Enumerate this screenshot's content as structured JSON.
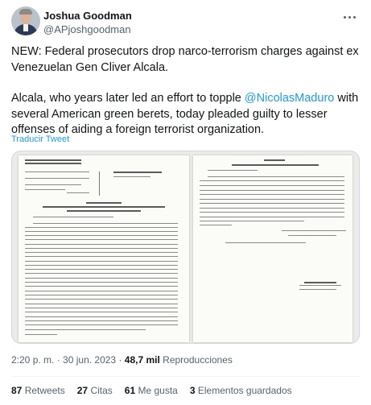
{
  "author": {
    "display_name": "Joshua Goodman",
    "handle": "@APjoshgoodman"
  },
  "tweet": {
    "line1": "NEW: Federal prosecutors drop narco-terrorism charges against ex Venezuelan Gen Cliver Alcala.",
    "line2_before": "Alcala, who years later led an effort to topple ",
    "mention": "@NicolasMaduro",
    "line2_after": " with several American green berets, today pleaded guilty to lesser offenses of aiding a foreign terrorist organization.",
    "translate_label": "Traducir Tweet"
  },
  "media": {
    "description": "Scanned court document pages"
  },
  "meta": {
    "time": "2:20 p. m.",
    "separator": " · ",
    "date": "30 jun. 2023",
    "views_count": "48,7 mil",
    "views_label": "Reproducciones"
  },
  "stats": {
    "retweets_count": "87",
    "retweets_label": "Retweets",
    "quotes_count": "27",
    "quotes_label": "Citas",
    "likes_count": "61",
    "likes_label": "Me gusta",
    "bookmarks_count": "3",
    "bookmarks_label": "Elementos guardados"
  },
  "icons": {
    "more": "more-horizontal-icon",
    "avatar": "avatar"
  }
}
